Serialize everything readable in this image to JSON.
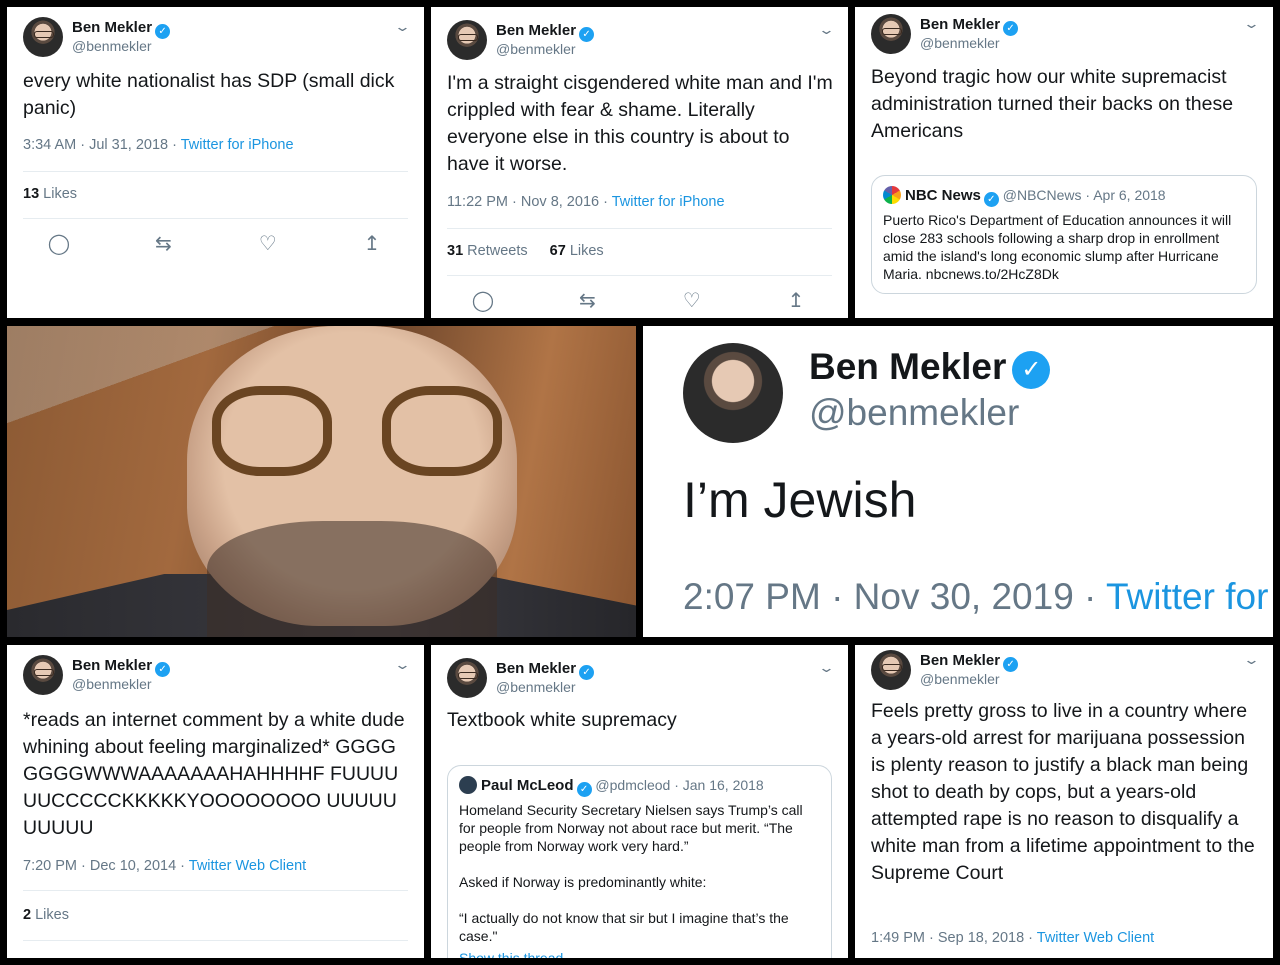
{
  "author": {
    "name": "Ben Mekler",
    "handle": "@benmekler"
  },
  "colors": {
    "link": "#1b95e0",
    "verified": "#1da1f2",
    "muted": "#657786",
    "text": "#14171a"
  },
  "icons": [
    "reply-icon",
    "retweet-icon",
    "like-icon",
    "share-icon",
    "verified-icon",
    "chevron-down-icon"
  ],
  "tweet1": {
    "text": "every white nationalist has SDP (small dick panic)",
    "time": "3:34 AM · Jul 31, 2018 · ",
    "source": "Twitter for iPhone",
    "likes_count": "13",
    "likes_label": " Likes"
  },
  "tweet2": {
    "text": "I'm a straight cisgendered white man and I'm crippled with fear & shame. Literally everyone else in this country is about to have it worse.",
    "time": "11:22 PM · Nov 8, 2016 · ",
    "source": "Twitter for iPhone",
    "retweets_count": "31",
    "retweets_label": " Retweets",
    "likes_count": "67",
    "likes_label": " Likes"
  },
  "tweet3": {
    "text": "Beyond tragic how our white supremacist administration turned their backs on these Americans",
    "quote": {
      "name": "NBC News",
      "handle": "@NBCNews · Apr 6, 2018",
      "text": "Puerto Rico's Department of Education announces it will close 283 schools following a sharp drop in enrollment amid the island's long economic slump after Hurricane Maria. nbcnews.to/2HcZ8Dk"
    }
  },
  "tweet_big": {
    "text": "I’m Jewish",
    "time": "2:07 PM · Nov 30, 2019 · ",
    "source": "Twitter for"
  },
  "tweet6": {
    "text": "*reads an internet comment by a white dude whining about feeling marginalized* GGGGGGGGWWWAAAAAAAHAHHHHF FUUUUUUCCCCCKKKKKYOOOOOOOO UUUUUUUUUU",
    "time": "7:20 PM · Dec 10, 2014 · ",
    "source": "Twitter Web Client",
    "likes_count": "2",
    "likes_label": " Likes"
  },
  "tweet7": {
    "text": "Textbook white supremacy",
    "quote": {
      "name": "Paul McLeod",
      "handle": "@pdmcleod · Jan 16, 2018",
      "text1": "Homeland Security Secretary Nielsen says Trump’s call for people from Norway not about race but merit. “The people from Norway work very hard.”",
      "text2": "Asked if Norway is predominantly white:",
      "text3": "“I actually do not know that sir but I imagine that’s the case.\"",
      "link": "Show this thread"
    }
  },
  "tweet8": {
    "text": "Feels pretty gross to live in a country where a years-old arrest for marijuana possession is plenty reason to justify a black man being shot to death by cops, but a years-old attempted rape is no reason to disqualify a white man from a lifetime appointment to the Supreme Court",
    "time": "1:49 PM · Sep 18, 2018 · ",
    "source": "Twitter Web Client"
  }
}
